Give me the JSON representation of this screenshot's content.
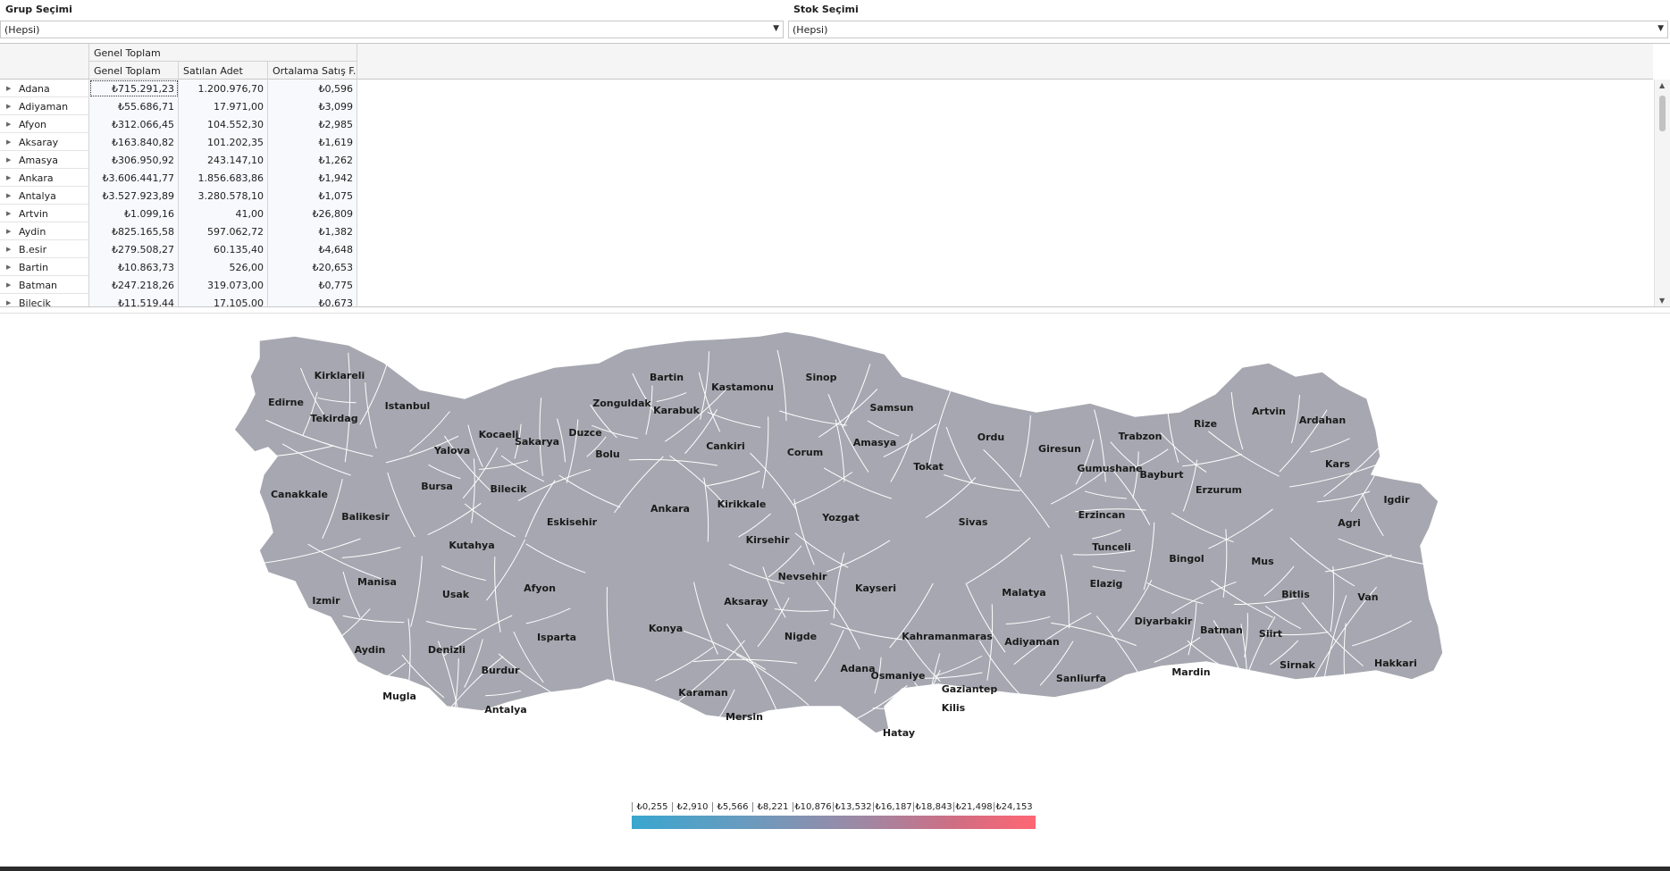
{
  "filters": {
    "grup": {
      "label": "Grup Seçimi",
      "value": "(Hepsi)"
    },
    "stok": {
      "label": "Stok Seçimi",
      "value": "(Hepsi)"
    }
  },
  "grid": {
    "group_header": "Genel Toplam",
    "columns": [
      "Genel Toplam",
      "Satılan Adet",
      "Ortalama Satış F..."
    ],
    "rows": [
      {
        "name": "Adana",
        "toplam": "₺715.291,23",
        "adet": "1.200.976,70",
        "ort": "₺0,596"
      },
      {
        "name": "Adiyaman",
        "toplam": "₺55.686,71",
        "adet": "17.971,00",
        "ort": "₺3,099"
      },
      {
        "name": "Afyon",
        "toplam": "₺312.066,45",
        "adet": "104.552,30",
        "ort": "₺2,985"
      },
      {
        "name": "Aksaray",
        "toplam": "₺163.840,82",
        "adet": "101.202,35",
        "ort": "₺1,619"
      },
      {
        "name": "Amasya",
        "toplam": "₺306.950,92",
        "adet": "243.147,10",
        "ort": "₺1,262"
      },
      {
        "name": "Ankara",
        "toplam": "₺3.606.441,77",
        "adet": "1.856.683,86",
        "ort": "₺1,942"
      },
      {
        "name": "Antalya",
        "toplam": "₺3.527.923,89",
        "adet": "3.280.578,10",
        "ort": "₺1,075"
      },
      {
        "name": "Artvin",
        "toplam": "₺1.099,16",
        "adet": "41,00",
        "ort": "₺26,809"
      },
      {
        "name": "Aydin",
        "toplam": "₺825.165,58",
        "adet": "597.062,72",
        "ort": "₺1,382"
      },
      {
        "name": "B.esir",
        "toplam": "₺279.508,27",
        "adet": "60.135,40",
        "ort": "₺4,648"
      },
      {
        "name": "Bartin",
        "toplam": "₺10.863,73",
        "adet": "526,00",
        "ort": "₺20,653"
      },
      {
        "name": "Batman",
        "toplam": "₺247.218,26",
        "adet": "319.073,00",
        "ort": "₺0,775"
      },
      {
        "name": "Bilecik",
        "toplam": "₺11.519,44",
        "adet": "17.105,00",
        "ort": "₺0,673"
      }
    ]
  },
  "map": {
    "fill_color": "#a6a7b0",
    "border_color": "#ffffff",
    "provinces": [
      "Kirklareli",
      "Edirne",
      "Istanbul",
      "Tekirdag",
      "Bartin",
      "Kastamonu",
      "Sinop",
      "Zonguldak",
      "Karabuk",
      "Samsun",
      "Artvin",
      "Rize",
      "Ardahan",
      "Kocaeli",
      "Sakarya",
      "Duzce",
      "Yalova",
      "Bolu",
      "Cankiri",
      "Corum",
      "Amasya",
      "Ordu",
      "Giresun",
      "Trabzon",
      "Gumushane",
      "Bayburt",
      "Tokat",
      "Kars",
      "Canakkale",
      "Bursa",
      "Bilecik",
      "Erzurum",
      "Igdir",
      "Balikesir",
      "Eskisehir",
      "Ankara",
      "Kirikkale",
      "Yozgat",
      "Sivas",
      "Erzincan",
      "Agri",
      "Kutahya",
      "Kirsehir",
      "Tunceli",
      "Bingol",
      "Mus",
      "Manisa",
      "Nevsehir",
      "Kayseri",
      "Malatya",
      "Elazig",
      "Afyon",
      "Usak",
      "Izmir",
      "Bitlis",
      "Van",
      "Aksaray",
      "Konya",
      "Isparta",
      "Diyarbakir",
      "Batman",
      "Siirt",
      "Nigde",
      "Kahramanmaras",
      "Adiyaman",
      "Aydin",
      "Denizli",
      "Burdur",
      "Sanliurfa",
      "Mardin",
      "Adana",
      "Osmaniye",
      "Sirnak",
      "Hakkari",
      "Gaziantep",
      "Mugla",
      "Karaman",
      "Antalya",
      "Kilis",
      "Mersin",
      "Hatay"
    ]
  },
  "legend": {
    "values": [
      "₺0,255",
      "₺2,910",
      "₺5,566",
      "₺8,221",
      "₺10,876",
      "₺13,532",
      "₺16,187",
      "₺18,843",
      "₺21,498",
      "₺24,153"
    ],
    "colors": {
      "low": "#39a6cf",
      "high": "#ff6673"
    }
  }
}
